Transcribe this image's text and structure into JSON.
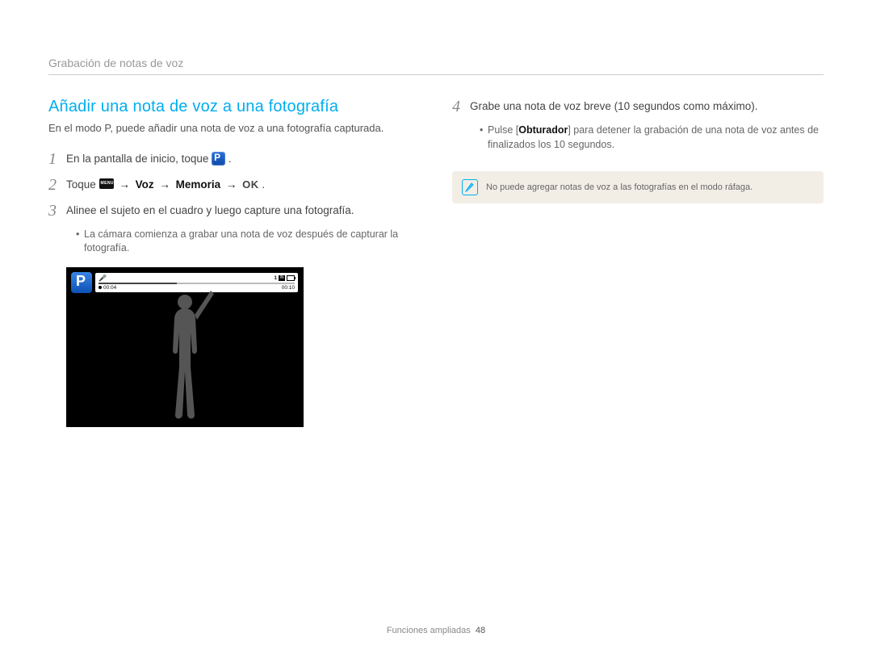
{
  "breadcrumb": "Grabación de notas de voz",
  "section_title": "Añadir una nota de voz a una fotografía",
  "intro": "En el modo P, puede añadir una nota de voz a una fotografía capturada.",
  "steps_left": {
    "s1": "En la pantalla de inicio, toque ",
    "s2_prefix": "Toque ",
    "s2_voz": "Voz",
    "s2_memoria": "Memoria",
    "s2_ok": "OK",
    "s3": "Alinee el sujeto en el cuadro y luego capture una fotografía.",
    "s3_sub": "La cámara comienza a grabar una nota de voz después de capturar la fotografía."
  },
  "camera_overlay": {
    "elapsed": "00:04",
    "total": "00:10",
    "counter": "1",
    "storage": "IN"
  },
  "steps_right": {
    "s4": "Grabe una nota de voz breve (10 segundos como máximo).",
    "s4_sub_prefix": "Pulse [",
    "s4_sub_shutter": "Obturador",
    "s4_sub_suffix": "] para detener la grabación de una nota de voz antes de finalizados los 10 segundos."
  },
  "note": "No puede agregar notas de voz a las fotografías en el modo ráfaga.",
  "footer": {
    "label": "Funciones ampliadas",
    "page": "48"
  }
}
